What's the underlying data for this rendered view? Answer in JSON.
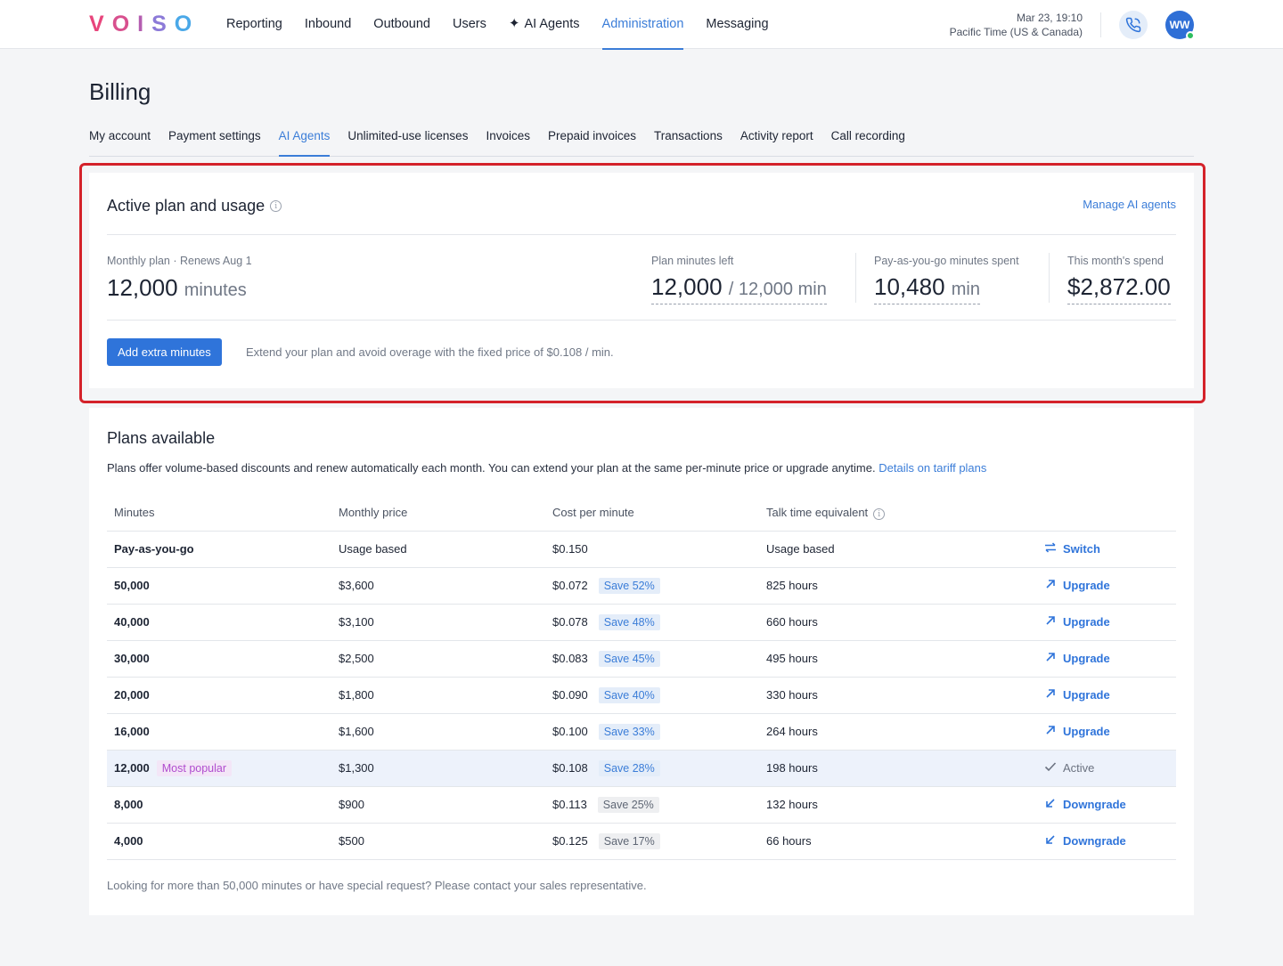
{
  "header": {
    "logo_letters": [
      "V",
      "O",
      "I",
      "S",
      "O"
    ],
    "nav": [
      {
        "label": "Reporting"
      },
      {
        "label": "Inbound"
      },
      {
        "label": "Outbound"
      },
      {
        "label": "Users"
      },
      {
        "label": "AI Agents"
      },
      {
        "label": "Administration"
      },
      {
        "label": "Messaging"
      }
    ],
    "active_nav": "Administration",
    "datetime": "Mar 23, 19:10",
    "timezone": "Pacific Time (US & Canada)",
    "avatar_initials": "WW"
  },
  "page": {
    "title": "Billing",
    "tabs": [
      {
        "label": "My account"
      },
      {
        "label": "Payment settings"
      },
      {
        "label": "AI Agents"
      },
      {
        "label": "Unlimited-use licenses"
      },
      {
        "label": "Invoices"
      },
      {
        "label": "Prepaid invoices"
      },
      {
        "label": "Transactions"
      },
      {
        "label": "Activity report"
      },
      {
        "label": "Call recording"
      }
    ],
    "active_tab": "AI Agents"
  },
  "active_plan": {
    "title": "Active plan and usage",
    "manage_link": "Manage AI agents",
    "plan_label": "Monthly plan · Renews Aug 1",
    "plan_value": "12,000",
    "plan_unit": "minutes",
    "minutes_left_label": "Plan minutes left",
    "minutes_left_value": "12,000",
    "minutes_left_total": "/ 12,000 min",
    "payg_label": "Pay-as-you-go minutes spent",
    "payg_value": "10,480",
    "payg_unit": "min",
    "spend_label": "This month's spend",
    "spend_value": "$2,872.00",
    "add_button": "Add extra minutes",
    "extend_note": "Extend your plan and avoid overage with the fixed price of $0.108 / min."
  },
  "plans": {
    "title": "Plans available",
    "description": "Plans offer volume-based discounts and renew automatically each month. You can extend your plan at the same per-minute price or upgrade anytime.",
    "details_link": "Details on tariff plans",
    "columns": [
      "Minutes",
      "Monthly price",
      "Cost per minute",
      "Talk time equivalent"
    ],
    "rows": [
      {
        "minutes": "Pay-as-you-go",
        "price": "Usage based",
        "cost": "$0.150",
        "save": "",
        "talk": "Usage based",
        "action": "Switch",
        "action_icon": "switch-icon",
        "badge": ""
      },
      {
        "minutes": "50,000",
        "price": "$3,600",
        "cost": "$0.072",
        "save": "Save 52%",
        "talk": "825 hours",
        "action": "Upgrade",
        "action_icon": "arrow-up-right-icon",
        "badge": ""
      },
      {
        "minutes": "40,000",
        "price": "$3,100",
        "cost": "$0.078",
        "save": "Save 48%",
        "talk": "660 hours",
        "action": "Upgrade",
        "action_icon": "arrow-up-right-icon",
        "badge": ""
      },
      {
        "minutes": "30,000",
        "price": "$2,500",
        "cost": "$0.083",
        "save": "Save 45%",
        "talk": "495 hours",
        "action": "Upgrade",
        "action_icon": "arrow-up-right-icon",
        "badge": ""
      },
      {
        "minutes": "20,000",
        "price": "$1,800",
        "cost": "$0.090",
        "save": "Save 40%",
        "talk": "330 hours",
        "action": "Upgrade",
        "action_icon": "arrow-up-right-icon",
        "badge": ""
      },
      {
        "minutes": "16,000",
        "price": "$1,600",
        "cost": "$0.100",
        "save": "Save 33%",
        "talk": "264 hours",
        "action": "Upgrade",
        "action_icon": "arrow-up-right-icon",
        "badge": ""
      },
      {
        "minutes": "12,000",
        "price": "$1,300",
        "cost": "$0.108",
        "save": "Save 28%",
        "talk": "198 hours",
        "action": "Active",
        "action_icon": "check-icon",
        "badge": "Most popular",
        "active": true
      },
      {
        "minutes": "8,000",
        "price": "$900",
        "cost": "$0.113",
        "save": "Save 25%",
        "talk": "132 hours",
        "action": "Downgrade",
        "action_icon": "arrow-down-left-icon",
        "badge": "",
        "muted_save": true
      },
      {
        "minutes": "4,000",
        "price": "$500",
        "cost": "$0.125",
        "save": "Save 17%",
        "talk": "66 hours",
        "action": "Downgrade",
        "action_icon": "arrow-down-left-icon",
        "badge": "",
        "muted_save": true
      }
    ],
    "footer_note": "Looking for more than 50,000 minutes or have special request? Please contact your sales representative."
  },
  "colors": {
    "accent": "#3b7dd8",
    "highlight_border": "#d4222a",
    "logo_gradient": [
      "#e8457c",
      "#c94a9a",
      "#9b6ad0",
      "#7d8fe0",
      "#4aa8e8"
    ]
  }
}
